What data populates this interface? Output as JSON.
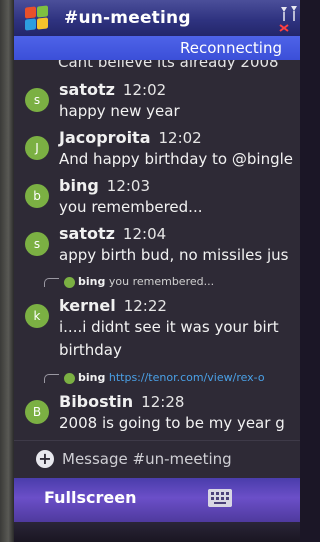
{
  "window": {
    "title": "#un-meeting"
  },
  "status": {
    "text": "Reconnecting"
  },
  "chat": {
    "partial_line": "Cant believe its already 2008",
    "messages": [
      {
        "avatar_letter": "s",
        "avatar_color": "#7bb043",
        "nick": "satotz",
        "time": "12:02",
        "text": "happy new year"
      },
      {
        "avatar_letter": "J",
        "avatar_color": "#7bb043",
        "nick": "Jacoproita",
        "time": "12:02",
        "text": "And happy birthday to @bingle"
      },
      {
        "avatar_letter": "b",
        "avatar_color": "#7bb043",
        "nick": "bing",
        "time": "12:03",
        "text": "you remembered..."
      },
      {
        "avatar_letter": "s",
        "avatar_color": "#7bb043",
        "nick": "satotz",
        "time": "12:04",
        "text": "appy birth bud, no missiles jus"
      },
      {
        "avatar_letter": "k",
        "avatar_color": "#7bb043",
        "nick": "kernel",
        "time": "12:22",
        "text": "i....i didnt see it was your birt",
        "text2": "birthday"
      },
      {
        "avatar_letter": "B",
        "avatar_color": "#7bb043",
        "nick": "Bibostin",
        "time": "12:28",
        "text": "2008 is going to be my year g"
      }
    ],
    "replies": [
      {
        "nick": "bing",
        "text": "you remembered..."
      },
      {
        "nick": "bing",
        "link": "https://tenor.com/view/rex-o"
      }
    ]
  },
  "composer": {
    "placeholder": "Message #un-meeting",
    "plus_icon": "plus-circle-icon"
  },
  "menubar": {
    "left_label": "Fullscreen",
    "right_icon": "keyboard-icon"
  },
  "colors": {
    "titlebar": "#2f3380",
    "statusbar": "#4e63e8",
    "menubar": "#6b4fc8",
    "link": "#4aa0e6",
    "avatar": "#7bb043"
  }
}
